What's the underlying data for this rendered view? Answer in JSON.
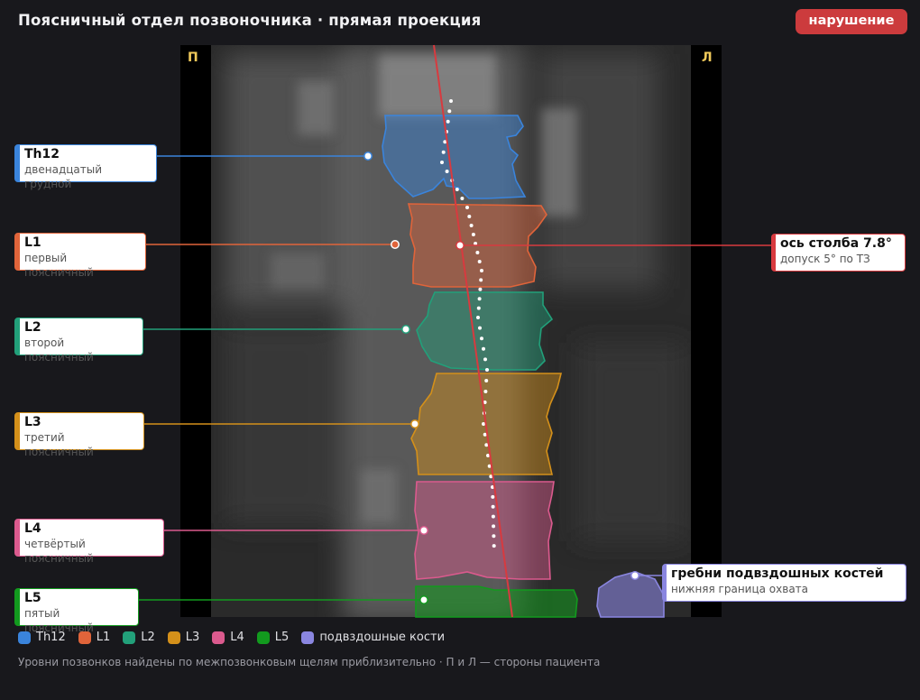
{
  "header": {
    "title": "Поясничный отдел позвоночника · прямая проекция",
    "status_badge": "нарушение"
  },
  "image": {
    "side_right_label": "П",
    "side_left_label": "Л"
  },
  "colors": {
    "Th12": "#3a84dc",
    "L1": "#e0643a",
    "L2": "#22a07a",
    "L3": "#d4901a",
    "L4": "#db5a8e",
    "L5": "#129a1e",
    "iliac": "#8a86e0",
    "axis": "#d83a3f"
  },
  "vertebrae": [
    {
      "key": "Th12",
      "label": "Th12",
      "desc": "двенадцатый грудной"
    },
    {
      "key": "L1",
      "label": "L1",
      "desc": "первый поясничный"
    },
    {
      "key": "L2",
      "label": "L2",
      "desc": "второй поясничный"
    },
    {
      "key": "L3",
      "label": "L3",
      "desc": "третий поясничный"
    },
    {
      "key": "L4",
      "label": "L4",
      "desc": "четвёртый поясничный"
    },
    {
      "key": "L5",
      "label": "L5",
      "desc": "пятый поясничный"
    }
  ],
  "axis_callout": {
    "title": "ось столба 7.8°",
    "subtitle": "допуск 5° по ТЗ"
  },
  "iliac_callout": {
    "title": "гребни подвздошных костей",
    "subtitle": "нижняя граница охвата"
  },
  "legend": [
    {
      "label": "Th12",
      "color_key": "Th12"
    },
    {
      "label": "L1",
      "color_key": "L1"
    },
    {
      "label": "L2",
      "color_key": "L2"
    },
    {
      "label": "L3",
      "color_key": "L3"
    },
    {
      "label": "L4",
      "color_key": "L4"
    },
    {
      "label": "L5",
      "color_key": "L5"
    },
    {
      "label": "подвздошные кости",
      "color_key": "iliac"
    }
  ],
  "footnote": "Уровни позвонков найдены по межпозвонковым щелям приблизительно · П и Л — стороны пациента"
}
